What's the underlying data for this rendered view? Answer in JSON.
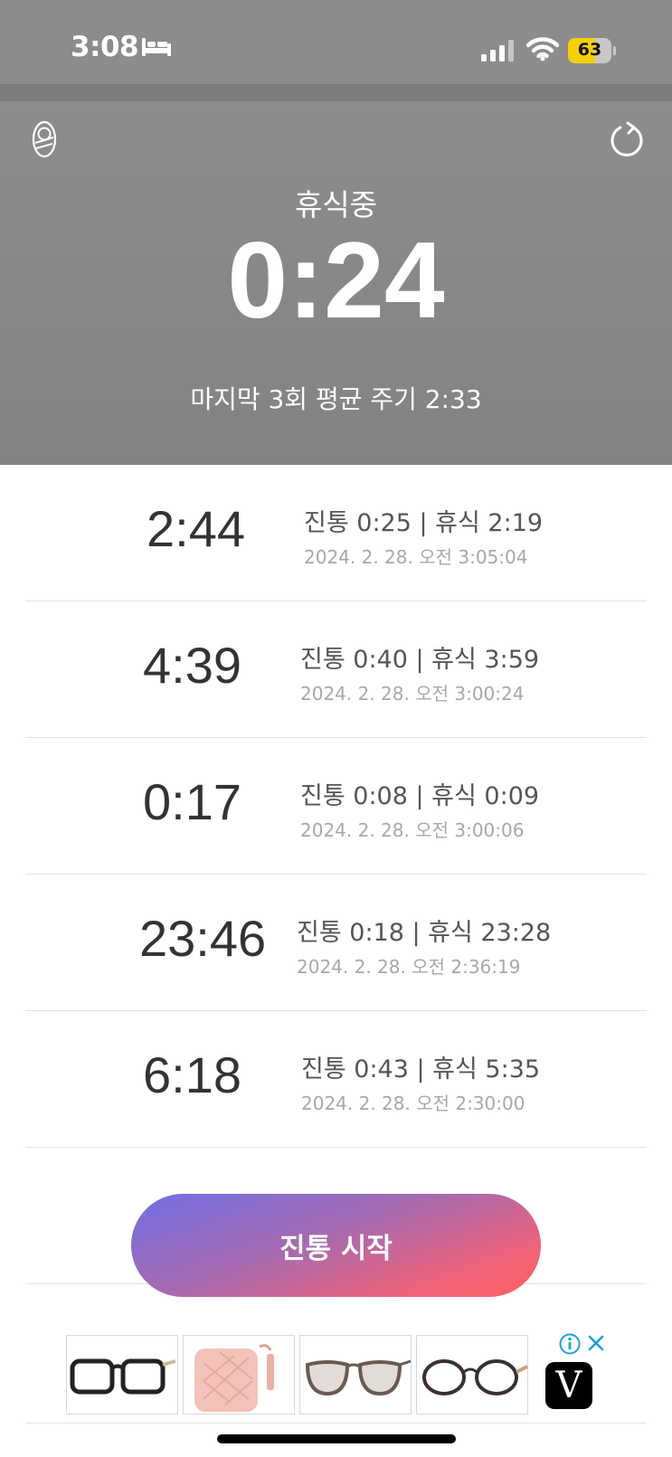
{
  "status_bar": {
    "time": "3:08",
    "battery_level": "63",
    "battery_percent": 63,
    "icons": [
      "bed-icon",
      "signal-icon",
      "wifi-icon",
      "battery-icon"
    ]
  },
  "header": {
    "status_label": "휴식중",
    "timer": "0:24",
    "average_text": "마지막 3회 평균 주기 2:33",
    "icons": [
      "baby-icon",
      "reset-icon"
    ]
  },
  "records": [
    {
      "total": "2:44",
      "info": "진통 0:25 | 휴식 2:19",
      "date": "2024. 2. 28. 오전 3:05:04"
    },
    {
      "total": "4:39",
      "info": "진통 0:40 | 휴식 3:59",
      "date": "2024. 2. 28. 오전 3:00:24"
    },
    {
      "total": "0:17",
      "info": "진통 0:08 | 휴식 0:09",
      "date": "2024. 2. 28. 오전 3:00:06"
    },
    {
      "total": "23:46",
      "info": "진통 0:18 | 휴식 23:28",
      "date": "2024. 2. 28. 오전 2:36:19"
    },
    {
      "total": "6:18",
      "info": "진통 0:43 | 휴식 5:35",
      "date": "2024. 2. 28. 오전 2:30:00"
    }
  ],
  "start_button": {
    "label": "진통 시작"
  },
  "ad": {
    "logo_letter": "V",
    "colors": {
      "gradient_start": "#7070e6",
      "gradient_end": "#ff6060"
    }
  }
}
